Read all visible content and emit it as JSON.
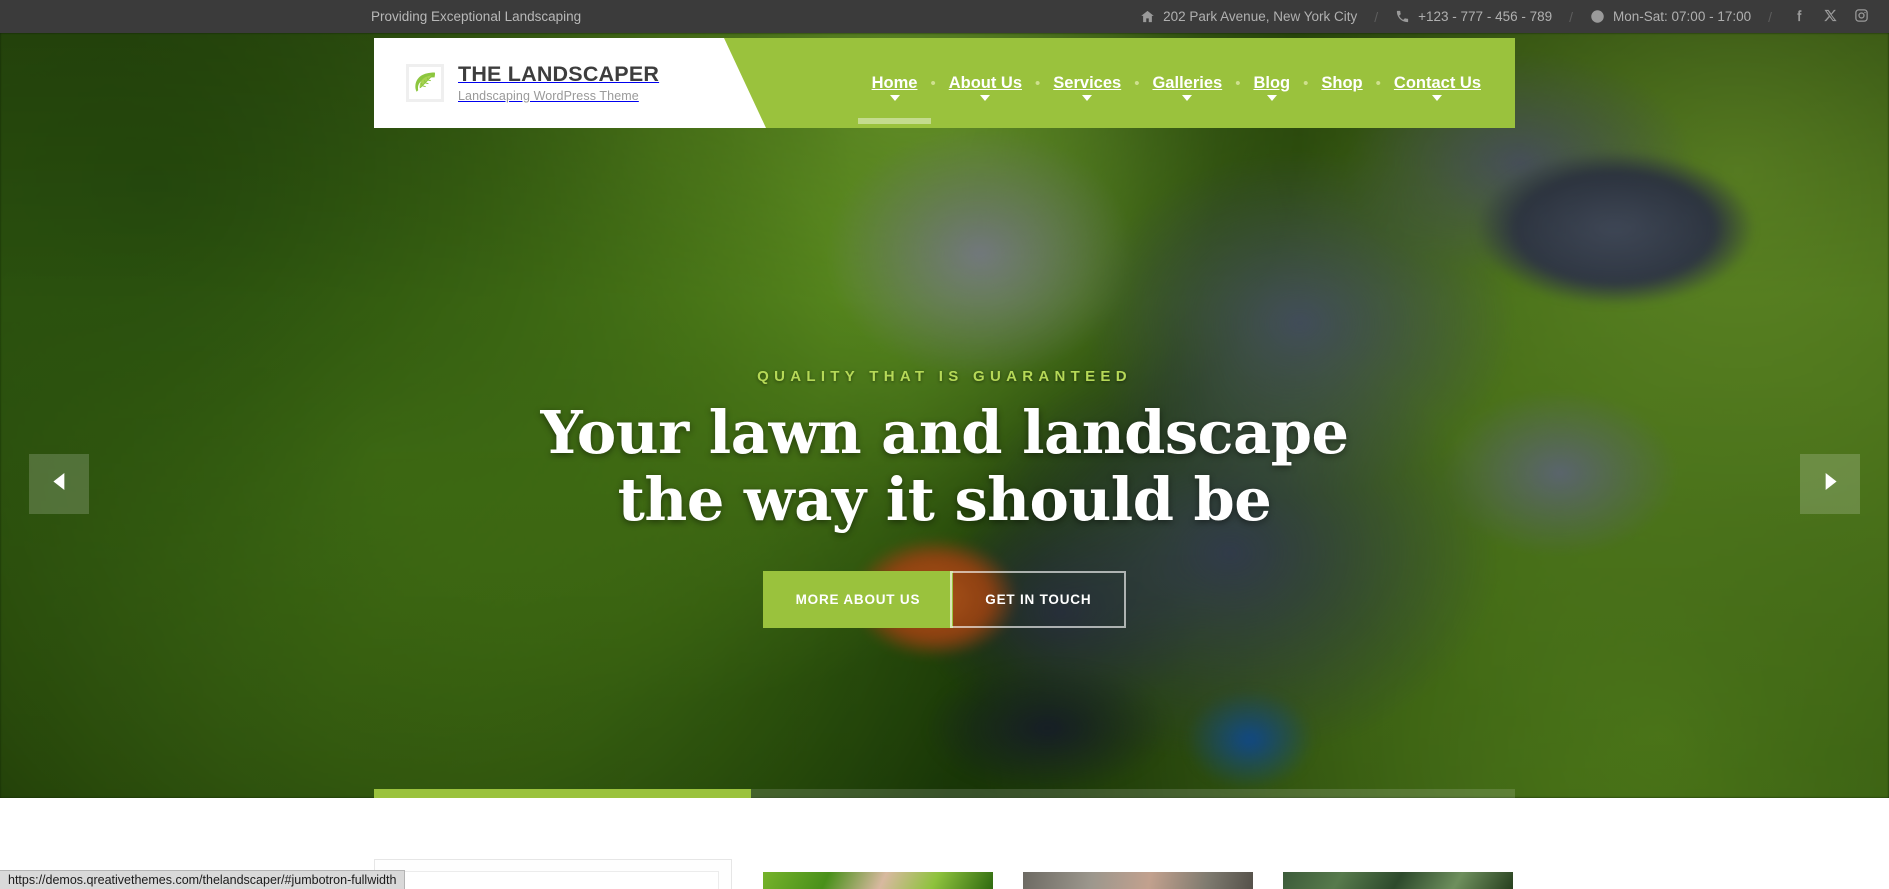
{
  "topbar": {
    "tagline": "Providing Exceptional Landscaping",
    "address": "202 Park Avenue, New York City",
    "phone": "+123 - 777 - 456 - 789",
    "hours": "Mon-Sat: 07:00 - 17:00",
    "separator": "/",
    "icons": {
      "address": "home-icon",
      "phone": "phone-icon",
      "hours": "clock-icon"
    },
    "social": [
      {
        "name": "facebook-icon",
        "label": "Facebook"
      },
      {
        "name": "x-twitter-icon",
        "label": "X"
      },
      {
        "name": "instagram-icon",
        "label": "Instagram"
      }
    ]
  },
  "header": {
    "logo": {
      "mark": "leaf-icon",
      "title": "THE LANDSCAPER",
      "subtitle": "Landscaping WordPress Theme"
    },
    "nav": [
      {
        "label": "Home",
        "has_dropdown": true,
        "active": true
      },
      {
        "label": "About Us",
        "has_dropdown": true,
        "active": false
      },
      {
        "label": "Services",
        "has_dropdown": true,
        "active": false
      },
      {
        "label": "Galleries",
        "has_dropdown": true,
        "active": false
      },
      {
        "label": "Blog",
        "has_dropdown": true,
        "active": false
      },
      {
        "label": "Shop",
        "has_dropdown": false,
        "active": false
      },
      {
        "label": "Contact Us",
        "has_dropdown": true,
        "active": false
      }
    ],
    "nav_dot": "•"
  },
  "hero": {
    "kicker": "Quality that is guaranteed",
    "title_line1": "Your lawn and landscape",
    "title_line2": "the way it should be",
    "buttons": [
      {
        "label": "More About Us",
        "style": "solid"
      },
      {
        "label": "Get in Touch",
        "style": "ghost"
      }
    ],
    "prev_arrow": "chevron-left-icon",
    "next_arrow": "chevron-right-icon",
    "progress_percent": 33
  },
  "statusbar": {
    "url": "https://demos.qreativethemes.com/thelandscaper/#jumbotron-fullwidth"
  },
  "colors": {
    "brand_green": "#9ac23d",
    "topbar_dark": "#3b3b3b",
    "kicker_green": "#b6d957",
    "logo_text": "#3d3d3d"
  }
}
